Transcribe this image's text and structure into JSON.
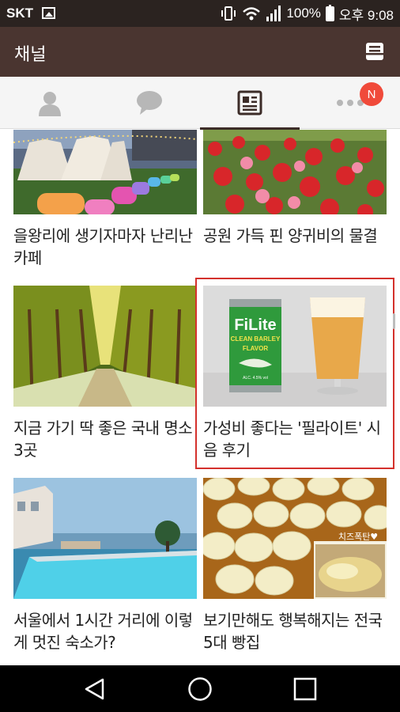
{
  "status_bar": {
    "carrier": "SKT",
    "battery": "100%",
    "time": "오후 9:08"
  },
  "header": {
    "title": "채널"
  },
  "tabs": {
    "badge": "N"
  },
  "cards": [
    {
      "caption": "을왕리에 생기자마자 난리난 카페"
    },
    {
      "caption": "공원 가득 핀 양귀비의 물결"
    },
    {
      "caption": "지금 가기 딱 좋은 국내 명소 3곳"
    },
    {
      "caption": "가성비 좋다는 '필라이트' 시음 후기",
      "can_text": "FiLite",
      "can_sub": "CLEAN BARLEY",
      "can_flavor": "FLAVOR",
      "can_abv": "ALC. 4.5% vol"
    },
    {
      "caption": "서울에서 1시간 거리에 이렇게 멋진 숙소가?"
    },
    {
      "caption": "보기만해도 행복해지는 전국 5대 빵집",
      "photo_text": "치즈폭탄♥"
    }
  ],
  "colors": {
    "status_bar": "#2b2320",
    "header": "#4a3530",
    "selection_outline": "#d4312c",
    "badge": "#f04a3a"
  }
}
